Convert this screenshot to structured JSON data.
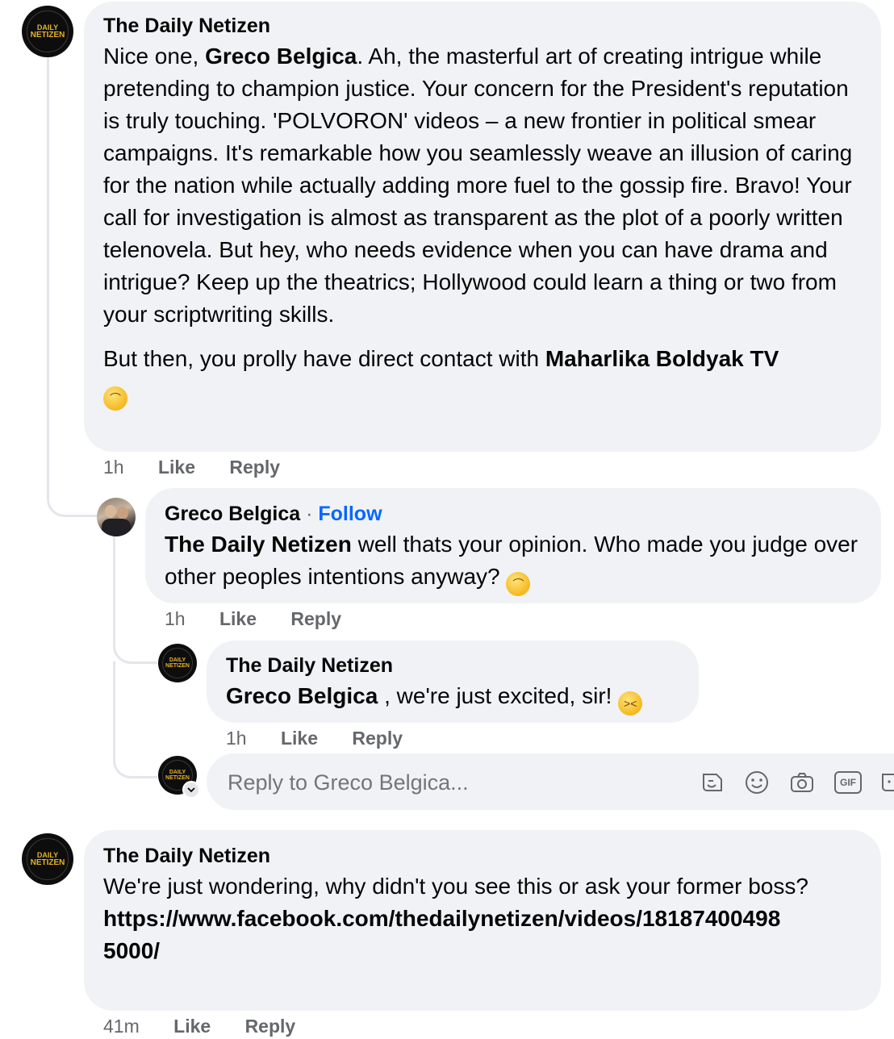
{
  "comment1": {
    "author": "The Daily Netizen",
    "mention": "Greco Belgica",
    "intro": "Nice one, ",
    "body": ". Ah, the masterful art of creating intrigue while pretending to champion justice. Your concern for the President's reputation is truly touching. 'POLVORON' videos – a new frontier in political smear campaigns. It's remarkable how you seamlessly weave an illusion of caring for the nation while actually adding more fuel to the gossip fire. Bravo! Your call for investigation is almost as transparent as the plot of a poorly written telenovela. But hey, who needs evidence when you can have drama and intrigue? Keep up the theatrics; Hollywood could learn a thing or two from your scriptwriting skills.",
    "p2_prefix": "But then, you prolly have direct contact with ",
    "p2_mention": "Maharlika Boldyak TV",
    "emoji": "sweat-smile-emoji",
    "time": "1h",
    "like": "Like",
    "reply": "Reply"
  },
  "reply1": {
    "author": "Greco Belgica",
    "separator": "·",
    "follow": "Follow",
    "mention": "The Daily Netizen",
    "body": " well thats your opinion. Who made you judge over other peoples intentions anyway?",
    "emoji": "sweat-smile-emoji",
    "time": "1h",
    "like": "Like",
    "reply": "Reply"
  },
  "reply2": {
    "author": "The Daily Netizen",
    "mention": "Greco Belgica",
    "body": " , we're just excited, sir!",
    "emoji": "grinning-squint-emoji",
    "time": "1h",
    "like": "Like",
    "reply": "Reply"
  },
  "composer": {
    "placeholder": "Reply to Greco Belgica...",
    "icons": [
      "sticker-icon",
      "emoji-icon",
      "camera-icon",
      "gif-icon",
      "sticker-alt-icon"
    ],
    "gif_label": "GIF"
  },
  "comment2": {
    "author": "The Daily Netizen",
    "body": "We're just wondering, why didn't you see this or ask your former boss?",
    "link_line1": "https://www.facebook.com/thedailynetizen/videos/18187400498",
    "link_line2": "5000/",
    "time": "41m",
    "like": "Like",
    "reply": "Reply"
  },
  "avatar_logo": {
    "line1": "DAILY",
    "line2": "NETIZEN"
  },
  "colors": {
    "bubble": "#f0f2f5",
    "link": "#0866ff",
    "meta": "#65676b",
    "logo_gold": "#e6b325"
  }
}
